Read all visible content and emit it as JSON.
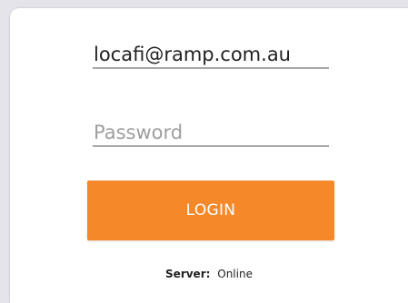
{
  "login_form": {
    "email_value": "locafi@ramp.com.au",
    "password_placeholder": "Password",
    "login_button_label": "LOGIN"
  },
  "server_status": {
    "label": "Server:",
    "value": "Online"
  },
  "colors": {
    "accent": "#f5892a",
    "underline": "#a8a8a8",
    "placeholder": "#9e9e9e"
  }
}
